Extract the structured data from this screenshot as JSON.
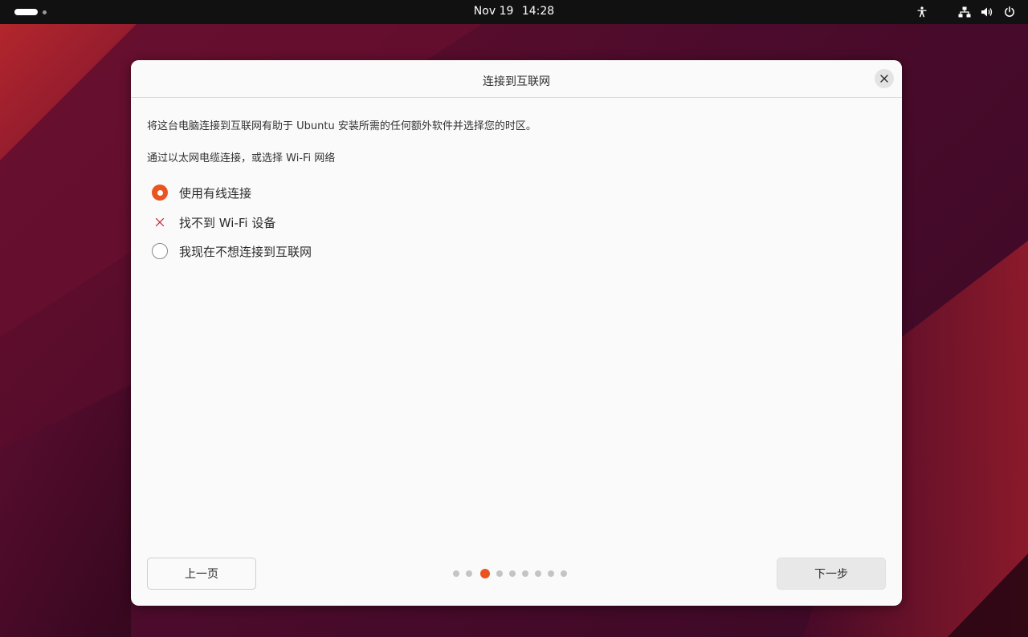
{
  "colors": {
    "accent": "#e95420",
    "topbar": "#111111",
    "dialog_bg": "#fafafa",
    "wallpaper": "#4d0b2c"
  },
  "topbar": {
    "date": "Nov 19",
    "time": "14:28",
    "icons": [
      "accessibility-icon",
      "network-icon",
      "volume-icon",
      "power-icon"
    ]
  },
  "dialog": {
    "title": "连接到互联网",
    "description": "将这台电脑连接到互联网有助于 Ubuntu 安装所需的任何额外软件并选择您的时区。",
    "subtitle": "通过以太网电缆连接，或选择 Wi-Fi 网络",
    "options": [
      {
        "label": "使用有线连接",
        "state": "selected"
      },
      {
        "label": "找不到 Wi-Fi 设备",
        "state": "unavailable"
      },
      {
        "label": "我现在不想连接到互联网",
        "state": "unselected"
      }
    ],
    "back_label": "上一页",
    "next_label": "下一步",
    "pager": {
      "total_steps": 10,
      "current_step": 3
    }
  }
}
